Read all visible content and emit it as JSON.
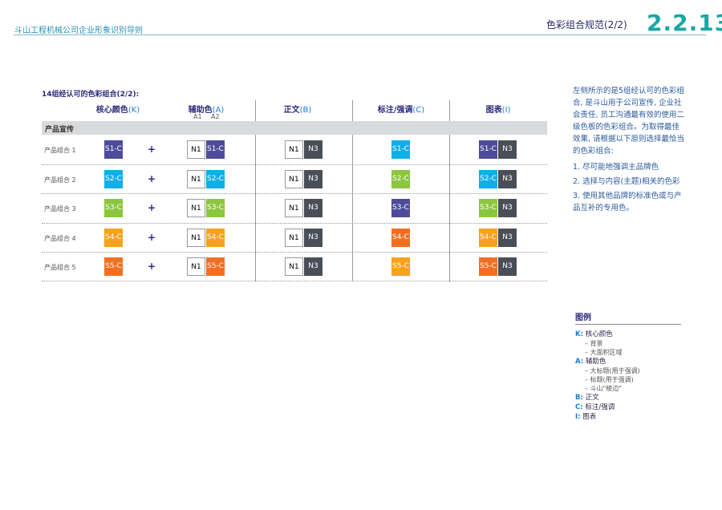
{
  "header": {
    "company": "斗山工程机械公司企业形象识别导则",
    "subtitle": "色彩组合规范(2/2)",
    "section_number": "2.2.13"
  },
  "table": {
    "title": "14组经认可的色彩组合(2/2):",
    "columns": [
      {
        "label": "核心颜色",
        "letter": "(K)"
      },
      {
        "label": "辅助色",
        "letter": "(A)"
      },
      {
        "label": "正文",
        "letter": "(B)"
      },
      {
        "label": "标注/强调",
        "letter": "(C)"
      },
      {
        "label": "图表",
        "letter": "(I)"
      }
    ],
    "aux_sub": [
      "A1",
      "A2"
    ],
    "group_label": "产品宣传",
    "plus": "+",
    "rows": [
      {
        "label": "产品组合 1",
        "core": "S1-C",
        "core_color": "#4e4c9a",
        "n1": "N1",
        "aux": "S1-C",
        "aux_color": "#4e4c9a",
        "body_n1": "N1",
        "body_n3": "N3",
        "accent": "S1-C",
        "accent_color": "#12aee8",
        "chart_c": "S1-C",
        "chart_color": "#4e4c9a",
        "chart_n3": "N3"
      },
      {
        "label": "产品组合 2",
        "core": "S2-C",
        "core_color": "#12aee8",
        "n1": "N1",
        "aux": "S2-C",
        "aux_color": "#12aee8",
        "body_n1": "N1",
        "body_n3": "N3",
        "accent": "S2-C",
        "accent_color": "#8cc63f",
        "chart_c": "S2-C",
        "chart_color": "#12aee8",
        "chart_n3": "N3"
      },
      {
        "label": "产品组合 3",
        "core": "S3-C",
        "core_color": "#8cc63f",
        "n1": "N1",
        "aux": "S3-C",
        "aux_color": "#8cc63f",
        "body_n1": "N1",
        "body_n3": "N3",
        "accent": "S3-C",
        "accent_color": "#4e4c9a",
        "chart_c": "S3-C",
        "chart_color": "#8cc63f",
        "chart_n3": "N3"
      },
      {
        "label": "产品组合 4",
        "core": "S4-C",
        "core_color": "#f6a21e",
        "n1": "N1",
        "aux": "S4-C",
        "aux_color": "#f6a21e",
        "body_n1": "N1",
        "body_n3": "N3",
        "accent": "S4-C",
        "accent_color": "#f07023",
        "chart_c": "S4-C",
        "chart_color": "#f6a21e",
        "chart_n3": "N3"
      },
      {
        "label": "产品组合 5",
        "core": "S5-C",
        "core_color": "#f07023",
        "n1": "N1",
        "aux": "S5-C",
        "aux_color": "#f07023",
        "body_n1": "N1",
        "body_n3": "N3",
        "accent": "S5-C",
        "accent_color": "#f6a21e",
        "chart_c": "S5-C",
        "chart_color": "#f07023",
        "chart_n3": "N3"
      }
    ],
    "n3_color": "#4a4f57"
  },
  "side": {
    "intro": "左侧所示的是5组经认可的色彩组合, 是斗山用于公司宣传, 企业社会责任, 员工沟通最有效的使用二级色板的色彩组合。为取得最佳效果, 请根据以下原则选择最恰当的色彩组合:",
    "points": [
      "1. 尽可能地强调主品牌色",
      "2. 选择与内容(主题)相关的色彩",
      "3. 使用其他品牌的标准色或与产品互补的专用色。"
    ]
  },
  "legend": {
    "title": "图例",
    "items": [
      {
        "key": "K:",
        "label": "核心颜色",
        "subs": [
          "–  背景",
          "–  大面积区域"
        ]
      },
      {
        "key": "A:",
        "label": "辅助色",
        "subs": [
          "–  大标题(用于强调)",
          "–  标题(用于强调)",
          "–  斗山\"棱边\""
        ]
      },
      {
        "key": "B:",
        "label": "正文",
        "subs": []
      },
      {
        "key": "C:",
        "label": "标注/强调",
        "subs": []
      },
      {
        "key": "I:",
        "label": "图表",
        "subs": []
      }
    ]
  }
}
